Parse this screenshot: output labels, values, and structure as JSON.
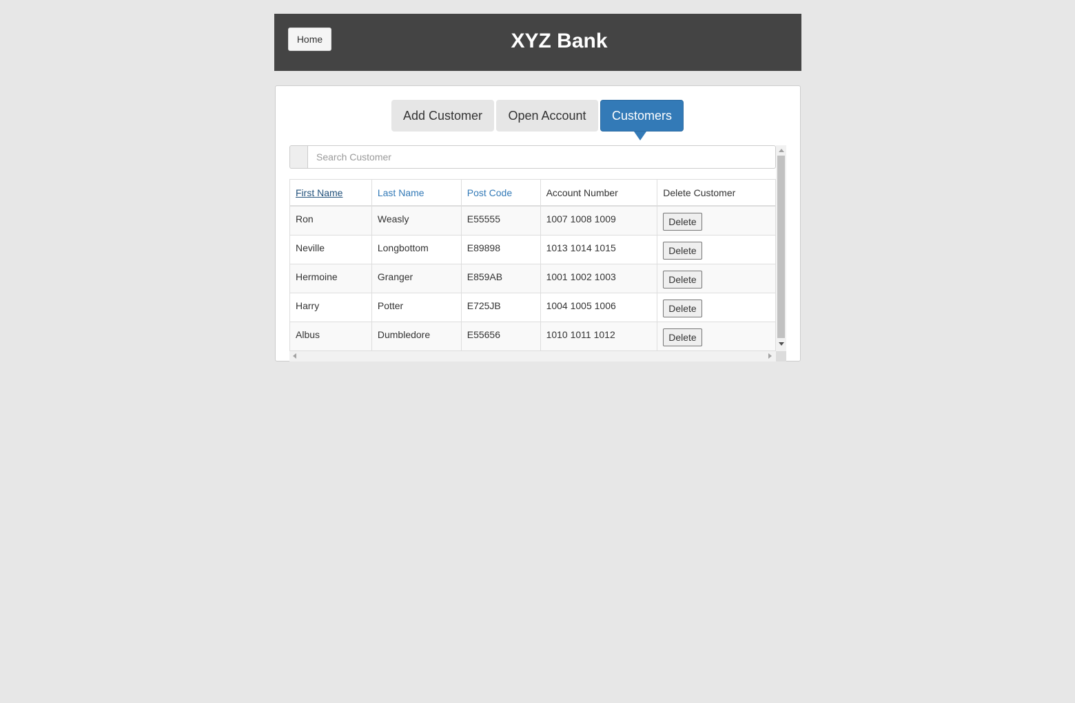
{
  "header": {
    "home_label": "Home",
    "title": "XYZ Bank"
  },
  "tabs": {
    "add_customer": "Add Customer",
    "open_account": "Open Account",
    "customers": "Customers",
    "active": "Customers"
  },
  "search": {
    "placeholder": "Search Customer",
    "value": ""
  },
  "table": {
    "columns": [
      "First Name",
      "Last Name",
      "Post Code",
      "Account Number",
      "Delete Customer"
    ],
    "sorted_by": "First Name",
    "rows": [
      {
        "first": "Ron",
        "last": "Weasly",
        "post": "E55555",
        "account": "1007 1008 1009",
        "action": "Delete"
      },
      {
        "first": "Neville",
        "last": "Longbottom",
        "post": "E89898",
        "account": "1013 1014 1015",
        "action": "Delete"
      },
      {
        "first": "Hermoine",
        "last": "Granger",
        "post": "E859AB",
        "account": "1001 1002 1003",
        "action": "Delete"
      },
      {
        "first": "Harry",
        "last": "Potter",
        "post": "E725JB",
        "account": "1004 1005 1006",
        "action": "Delete"
      },
      {
        "first": "Albus",
        "last": "Dumbledore",
        "post": "E55656",
        "account": "1010 1011 1012",
        "action": "Delete"
      }
    ]
  },
  "colors": {
    "header_bg": "#444444",
    "page_bg": "#e7e7e7",
    "accent": "#337ab7",
    "link": "#337ab7"
  }
}
